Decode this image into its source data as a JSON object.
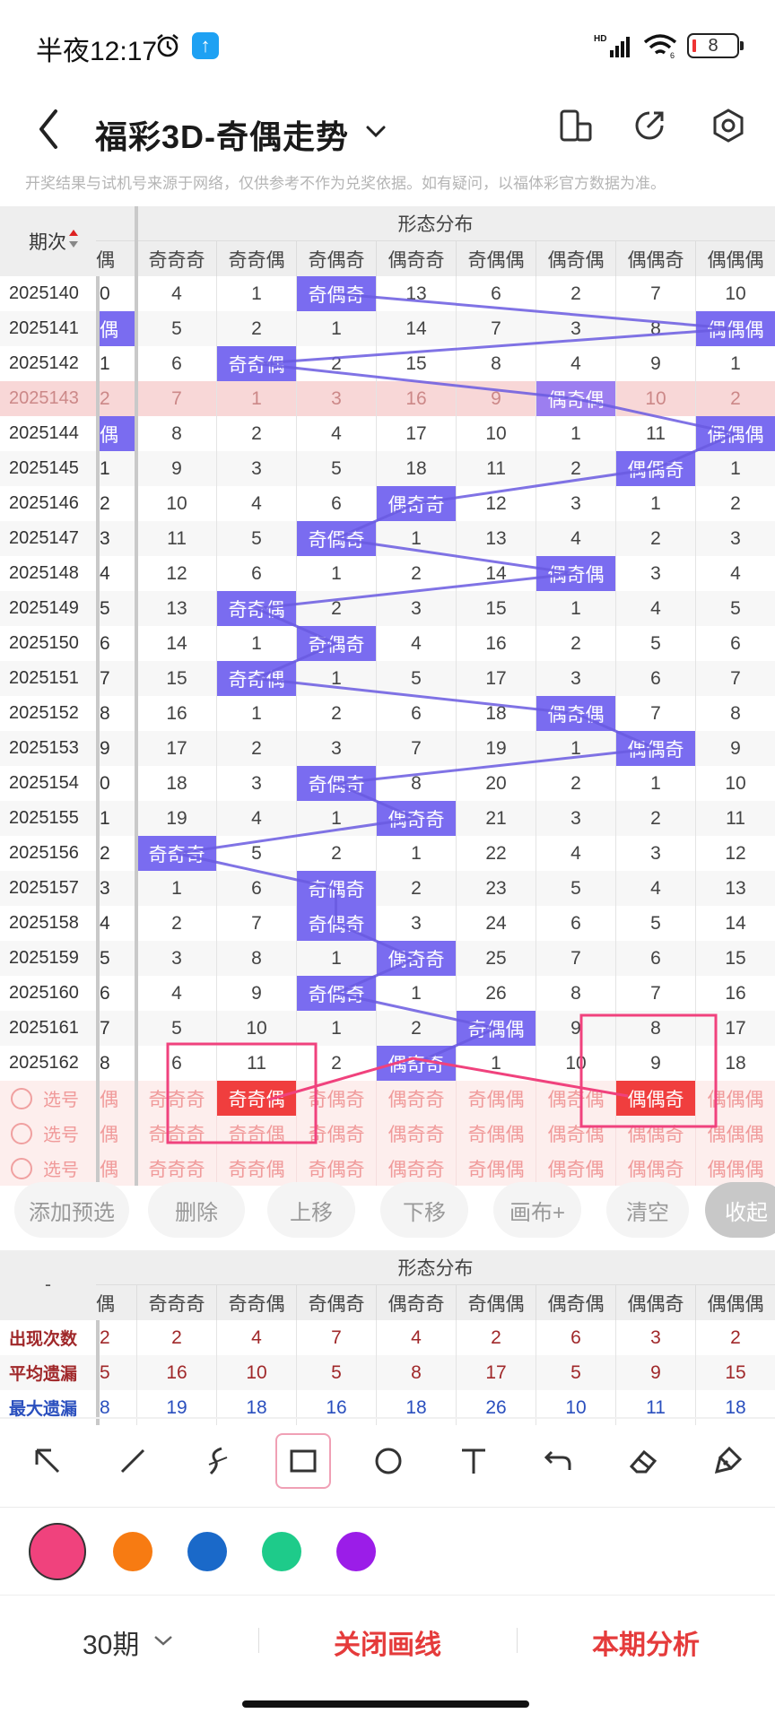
{
  "status_bar": {
    "time": "半夜12:17",
    "network": "HD",
    "wifi_sub": "6",
    "battery": "8"
  },
  "header": {
    "title": "福彩3D-奇偶走势"
  },
  "disclaimer": "开奖结果与试机号来源于网络，仅供参考不作为兑奖依据。如有疑问，以福体彩官方数据为准。",
  "grid": {
    "issue_header": "期次",
    "section_title": "形态分布",
    "partial_header": "偶",
    "columns": [
      "奇奇奇",
      "奇奇偶",
      "奇偶奇",
      "偶奇奇",
      "奇偶偶",
      "偶奇偶",
      "偶偶奇",
      "偶偶偶"
    ],
    "rows": [
      {
        "issue": "2025140",
        "partial": "0",
        "cells": [
          "4",
          "1",
          "奇偶奇",
          "13",
          "6",
          "2",
          "7",
          "10"
        ]
      },
      {
        "issue": "2025141",
        "partial": "偶",
        "cells": [
          "5",
          "2",
          "1",
          "14",
          "7",
          "3",
          "8",
          "偶偶偶"
        ]
      },
      {
        "issue": "2025142",
        "partial": "1",
        "cells": [
          "6",
          "奇奇偶",
          "2",
          "15",
          "8",
          "4",
          "9",
          "1"
        ]
      },
      {
        "issue": "2025143",
        "partial": "2",
        "cells": [
          "7",
          "1",
          "3",
          "16",
          "9",
          "偶奇偶",
          "10",
          "2"
        ]
      },
      {
        "issue": "2025144",
        "partial": "偶",
        "cells": [
          "8",
          "2",
          "4",
          "17",
          "10",
          "1",
          "11",
          "偶偶偶"
        ]
      },
      {
        "issue": "2025145",
        "partial": "1",
        "cells": [
          "9",
          "3",
          "5",
          "18",
          "11",
          "2",
          "偶偶奇",
          "1"
        ]
      },
      {
        "issue": "2025146",
        "partial": "2",
        "cells": [
          "10",
          "4",
          "6",
          "偶奇奇",
          "12",
          "3",
          "1",
          "2"
        ]
      },
      {
        "issue": "2025147",
        "partial": "3",
        "cells": [
          "11",
          "5",
          "奇偶奇",
          "1",
          "13",
          "4",
          "2",
          "3"
        ]
      },
      {
        "issue": "2025148",
        "partial": "4",
        "cells": [
          "12",
          "6",
          "1",
          "2",
          "14",
          "偶奇偶",
          "3",
          "4"
        ]
      },
      {
        "issue": "2025149",
        "partial": "5",
        "cells": [
          "13",
          "奇奇偶",
          "2",
          "3",
          "15",
          "1",
          "4",
          "5"
        ]
      },
      {
        "issue": "2025150",
        "partial": "6",
        "cells": [
          "14",
          "1",
          "奇偶奇",
          "4",
          "16",
          "2",
          "5",
          "6"
        ]
      },
      {
        "issue": "2025151",
        "partial": "7",
        "cells": [
          "15",
          "奇奇偶",
          "1",
          "5",
          "17",
          "3",
          "6",
          "7"
        ]
      },
      {
        "issue": "2025152",
        "partial": "8",
        "cells": [
          "16",
          "1",
          "2",
          "6",
          "18",
          "偶奇偶",
          "7",
          "8"
        ]
      },
      {
        "issue": "2025153",
        "partial": "9",
        "cells": [
          "17",
          "2",
          "3",
          "7",
          "19",
          "1",
          "偶偶奇",
          "9"
        ]
      },
      {
        "issue": "2025154",
        "partial": "0",
        "cells": [
          "18",
          "3",
          "奇偶奇",
          "8",
          "20",
          "2",
          "1",
          "10"
        ]
      },
      {
        "issue": "2025155",
        "partial": "1",
        "cells": [
          "19",
          "4",
          "1",
          "偶奇奇",
          "21",
          "3",
          "2",
          "11"
        ]
      },
      {
        "issue": "2025156",
        "partial": "2",
        "cells": [
          "奇奇奇",
          "5",
          "2",
          "1",
          "22",
          "4",
          "3",
          "12"
        ]
      },
      {
        "issue": "2025157",
        "partial": "3",
        "cells": [
          "1",
          "6",
          "奇偶奇",
          "2",
          "23",
          "5",
          "4",
          "13"
        ]
      },
      {
        "issue": "2025158",
        "partial": "4",
        "cells": [
          "2",
          "7",
          "奇偶奇",
          "3",
          "24",
          "6",
          "5",
          "14"
        ]
      },
      {
        "issue": "2025159",
        "partial": "5",
        "cells": [
          "3",
          "8",
          "1",
          "偶奇奇",
          "25",
          "7",
          "6",
          "15"
        ]
      },
      {
        "issue": "2025160",
        "partial": "6",
        "cells": [
          "4",
          "9",
          "奇偶奇",
          "1",
          "26",
          "8",
          "7",
          "16"
        ]
      },
      {
        "issue": "2025161",
        "partial": "7",
        "cells": [
          "5",
          "10",
          "1",
          "2",
          "奇偶偶",
          "9",
          "8",
          "17"
        ]
      },
      {
        "issue": "2025162",
        "partial": "8",
        "cells": [
          "6",
          "11",
          "2",
          "偶奇奇",
          "1",
          "10",
          "9",
          "18"
        ]
      }
    ],
    "select_label": "选号",
    "select_rows": [
      {
        "partial": "偶",
        "cells": [
          "奇奇奇",
          "奇奇偶",
          "奇偶奇",
          "偶奇奇",
          "奇偶偶",
          "偶奇偶",
          "偶偶奇",
          "偶偶偶"
        ]
      },
      {
        "partial": "偶",
        "cells": [
          "奇奇奇",
          "奇奇偶",
          "奇偶奇",
          "偶奇奇",
          "奇偶偶",
          "偶奇偶",
          "偶偶奇",
          "偶偶偶"
        ]
      },
      {
        "partial": "偶",
        "cells": [
          "奇奇奇",
          "奇奇偶",
          "奇偶奇",
          "偶奇奇",
          "奇偶偶",
          "偶奇偶",
          "偶偶奇",
          "偶偶偶"
        ]
      }
    ]
  },
  "buttons": [
    "添加预选",
    "删除",
    "上移",
    "下移",
    "画布+",
    "清空",
    "收起"
  ],
  "stats": {
    "dash": "-",
    "section_title": "形态分布",
    "partial_header": "偶",
    "columns": [
      "奇奇奇",
      "奇奇偶",
      "奇偶奇",
      "偶奇奇",
      "奇偶偶",
      "偶奇偶",
      "偶偶奇",
      "偶偶偶"
    ],
    "rows": [
      {
        "label": "出现次数",
        "partial": "2",
        "values": [
          "2",
          "4",
          "7",
          "4",
          "2",
          "6",
          "3",
          "2"
        ]
      },
      {
        "label": "平均遗漏",
        "partial": "5",
        "values": [
          "16",
          "10",
          "5",
          "8",
          "17",
          "5",
          "9",
          "15"
        ]
      },
      {
        "label": "最大遗漏",
        "partial": "8",
        "values": [
          "19",
          "18",
          "16",
          "18",
          "26",
          "10",
          "11",
          "18"
        ]
      }
    ]
  },
  "tools": [
    "pointer-arrow-icon",
    "line-icon",
    "freehand-icon",
    "rectangle-icon",
    "circle-icon",
    "text-icon",
    "undo-icon",
    "eraser-icon",
    "clear-brush-icon"
  ],
  "colors": [
    "#f0427d",
    "#f77b12",
    "#1a69c9",
    "#1ecb8a",
    "#9b1de8"
  ],
  "bottom_bar": {
    "period": "30期",
    "close_lines": "关闭画线",
    "analysis": "本期分析"
  }
}
